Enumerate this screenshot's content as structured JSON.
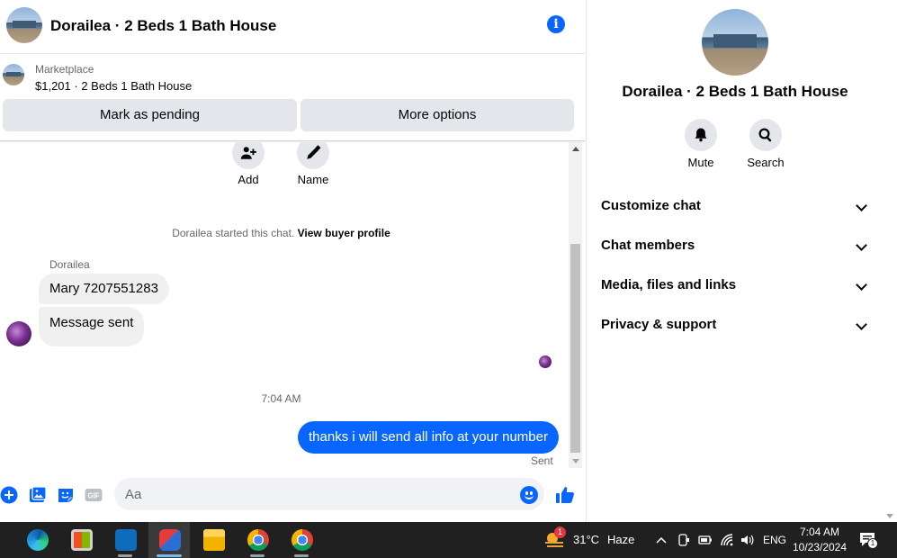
{
  "header": {
    "title": "Dorailea · 2 Beds 1 Bath House",
    "info_icon": "info-icon"
  },
  "marketplace": {
    "label": "Marketplace",
    "listing": "$1,201 · 2 Beds 1 Bath House",
    "mark_pending_label": "Mark as pending",
    "more_options_label": "More options"
  },
  "chat": {
    "actions": [
      {
        "label": "Add",
        "icon": "add-person-icon"
      },
      {
        "label": "Name",
        "icon": "pencil-icon"
      }
    ],
    "started_text": "Dorailea started this chat.",
    "view_profile_label": "View buyer profile",
    "sender_name": "Dorailea",
    "incoming": [
      "Mary 7207551283",
      "Message sent"
    ],
    "timestamp": "7:04 AM",
    "outgoing": "thanks i will send all info at your number",
    "status": "Sent"
  },
  "composer": {
    "placeholder": "Aa",
    "icons": [
      "plus-icon",
      "photo-icon",
      "sticker-icon",
      "gif-icon",
      "emoji-icon",
      "like-icon"
    ],
    "gif_label": "GIF"
  },
  "info_panel": {
    "title": "Dorailea · 2 Beds 1 Bath House",
    "actions": [
      {
        "label": "Mute",
        "icon": "bell-icon"
      },
      {
        "label": "Search",
        "icon": "search-icon"
      }
    ],
    "sections": [
      "Customize chat",
      "Chat members",
      "Media, files and links",
      "Privacy & support"
    ]
  },
  "taskbar": {
    "apps": [
      "edge-icon",
      "store-icon",
      "outlook-icon",
      "snipping-tool-icon",
      "file-explorer-icon",
      "chrome-icon",
      "chrome-profile-icon"
    ],
    "weather_badge": "1",
    "temperature": "31°C",
    "weather": "Haze",
    "language": "ENG",
    "time": "7:04 AM",
    "date": "10/23/2024",
    "notification_count": "1"
  },
  "colors": {
    "accent": "#0866ff",
    "bubble_incoming": "#f0f0f0",
    "button_bg": "#e4e6eb",
    "taskbar": "#202020"
  }
}
